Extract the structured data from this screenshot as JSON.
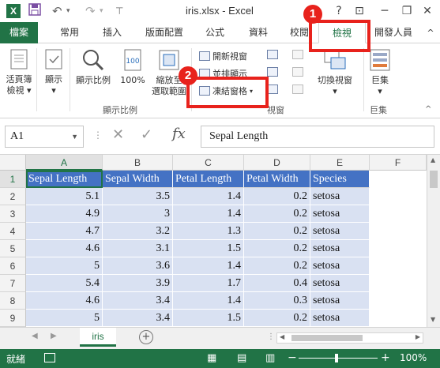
{
  "window": {
    "title": "iris.xlsx - Excel",
    "app_icon": "X",
    "help": "?",
    "minimize": "─",
    "close": "✕"
  },
  "tabs": {
    "file": "檔案",
    "items": [
      "常用",
      "插入",
      "版面配置",
      "公式",
      "資料",
      "校閱",
      "檢視",
      "開發人員"
    ],
    "active": "檢視"
  },
  "ribbon": {
    "view_normal_l1": "活頁簿",
    "view_normal_l2": "檢視",
    "show": "顯示",
    "zoom": "顯示比例",
    "zoom100": "100%",
    "zoom_sel_l1": "縮放至",
    "zoom_sel_l2": "選取範圍",
    "group_zoom": "顯示比例",
    "new_window": "開新視窗",
    "arrange": "並排顯示",
    "freeze": "凍結窗格",
    "group_window": "視窗",
    "switch_windows": "切換視窗",
    "macros": "巨集",
    "group_macros": "巨集"
  },
  "formula_bar": {
    "name_box": "A1",
    "fx": "fx",
    "content": "Sepal Length"
  },
  "columns": [
    "A",
    "B",
    "C",
    "D",
    "E",
    "F"
  ],
  "rows": [
    "1",
    "2",
    "3",
    "4",
    "5",
    "6",
    "7",
    "8",
    "9"
  ],
  "table": {
    "headers": [
      "Sepal Length",
      "Sepal Width",
      "Petal Length",
      "Petal Width",
      "Species"
    ],
    "data": [
      [
        "5.1",
        "3.5",
        "1.4",
        "0.2",
        "setosa"
      ],
      [
        "4.9",
        "3",
        "1.4",
        "0.2",
        "setosa"
      ],
      [
        "4.7",
        "3.2",
        "1.3",
        "0.2",
        "setosa"
      ],
      [
        "4.6",
        "3.1",
        "1.5",
        "0.2",
        "setosa"
      ],
      [
        "5",
        "3.6",
        "1.4",
        "0.2",
        "setosa"
      ],
      [
        "5.4",
        "3.9",
        "1.7",
        "0.4",
        "setosa"
      ],
      [
        "4.6",
        "3.4",
        "1.4",
        "0.3",
        "setosa"
      ],
      [
        "5",
        "3.4",
        "1.5",
        "0.2",
        "setosa"
      ]
    ]
  },
  "sheet_tabs": [
    "iris"
  ],
  "status": {
    "ready": "就緒",
    "zoom": "100%"
  },
  "callouts": [
    "1",
    "2"
  ],
  "colors": {
    "excel_green": "#217346",
    "table_header": "#4472c4",
    "table_band": "#d9e1f2",
    "callout_red": "#e8221c"
  }
}
